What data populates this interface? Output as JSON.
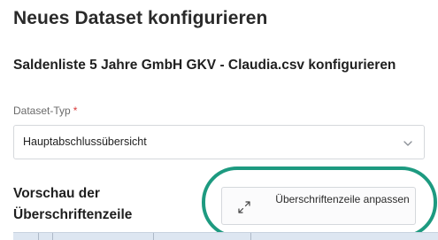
{
  "page": {
    "title": "Neues Dataset konfigurieren"
  },
  "section": {
    "title": "Saldenliste 5 Jahre GmbH GKV - Claudia.csv konfigurieren"
  },
  "dataset_type": {
    "label": "Dataset-Typ",
    "required_marker": "*",
    "selected_value": "Hauptabschlussübersicht",
    "chevron_icon": "chevron-down-icon"
  },
  "preview": {
    "heading": "Vorschau der Überschriftenzeile",
    "adjust_button_label": "Überschriftenzeile anpassen",
    "adjust_button_icon": "expand-arrows-icon",
    "highlight_color": "#1d9a80"
  },
  "colors": {
    "table_header_bg": "#dde6f1"
  }
}
